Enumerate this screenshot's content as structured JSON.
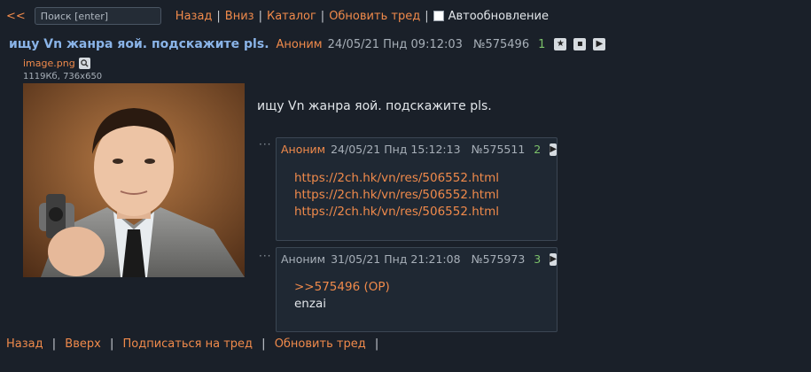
{
  "nav": {
    "back": "<<",
    "search_placeholder": "Поиск [enter]",
    "links": [
      "Назад",
      "Вниз",
      "Каталог",
      "Обновить тред"
    ],
    "auto_update": "Автообновление"
  },
  "op": {
    "title": "ищу Vn жанра яой. подскажите pls.",
    "author": "Аноним",
    "date": "24/05/21 Пнд 09:12:03",
    "number": "№575496",
    "count": "1",
    "file_name": "image.png",
    "file_meta": "1119Кб, 736x650",
    "text": "ищу Vn жанра яой. подскажите pls."
  },
  "replies": [
    {
      "author": "Аноним",
      "date": "24/05/21 Пнд 15:12:13",
      "number": "№575511",
      "count": "2",
      "links": [
        "https://2ch.hk/vn/res/506552.html",
        "https://2ch.hk/vn/res/506552.html",
        "https://2ch.hk/vn/res/506552.html"
      ]
    },
    {
      "author": "Аноним",
      "date": "31/05/21 Пнд 21:21:08",
      "number": "№575973",
      "count": "3",
      "quote": ">>575496 (OP)",
      "text": "enzai"
    }
  ],
  "bottom": {
    "links": [
      "Назад",
      "Вверх",
      "Подписаться на тред",
      "Обновить тред"
    ]
  },
  "icons": {
    "star": "star-icon",
    "hide": "hide-icon",
    "play": "play-icon",
    "magnify": "magnify-icon"
  },
  "colors": {
    "background": "#1a2029",
    "link": "#f08a4b",
    "title": "#8ab4e8",
    "count": "#7cc26a"
  }
}
